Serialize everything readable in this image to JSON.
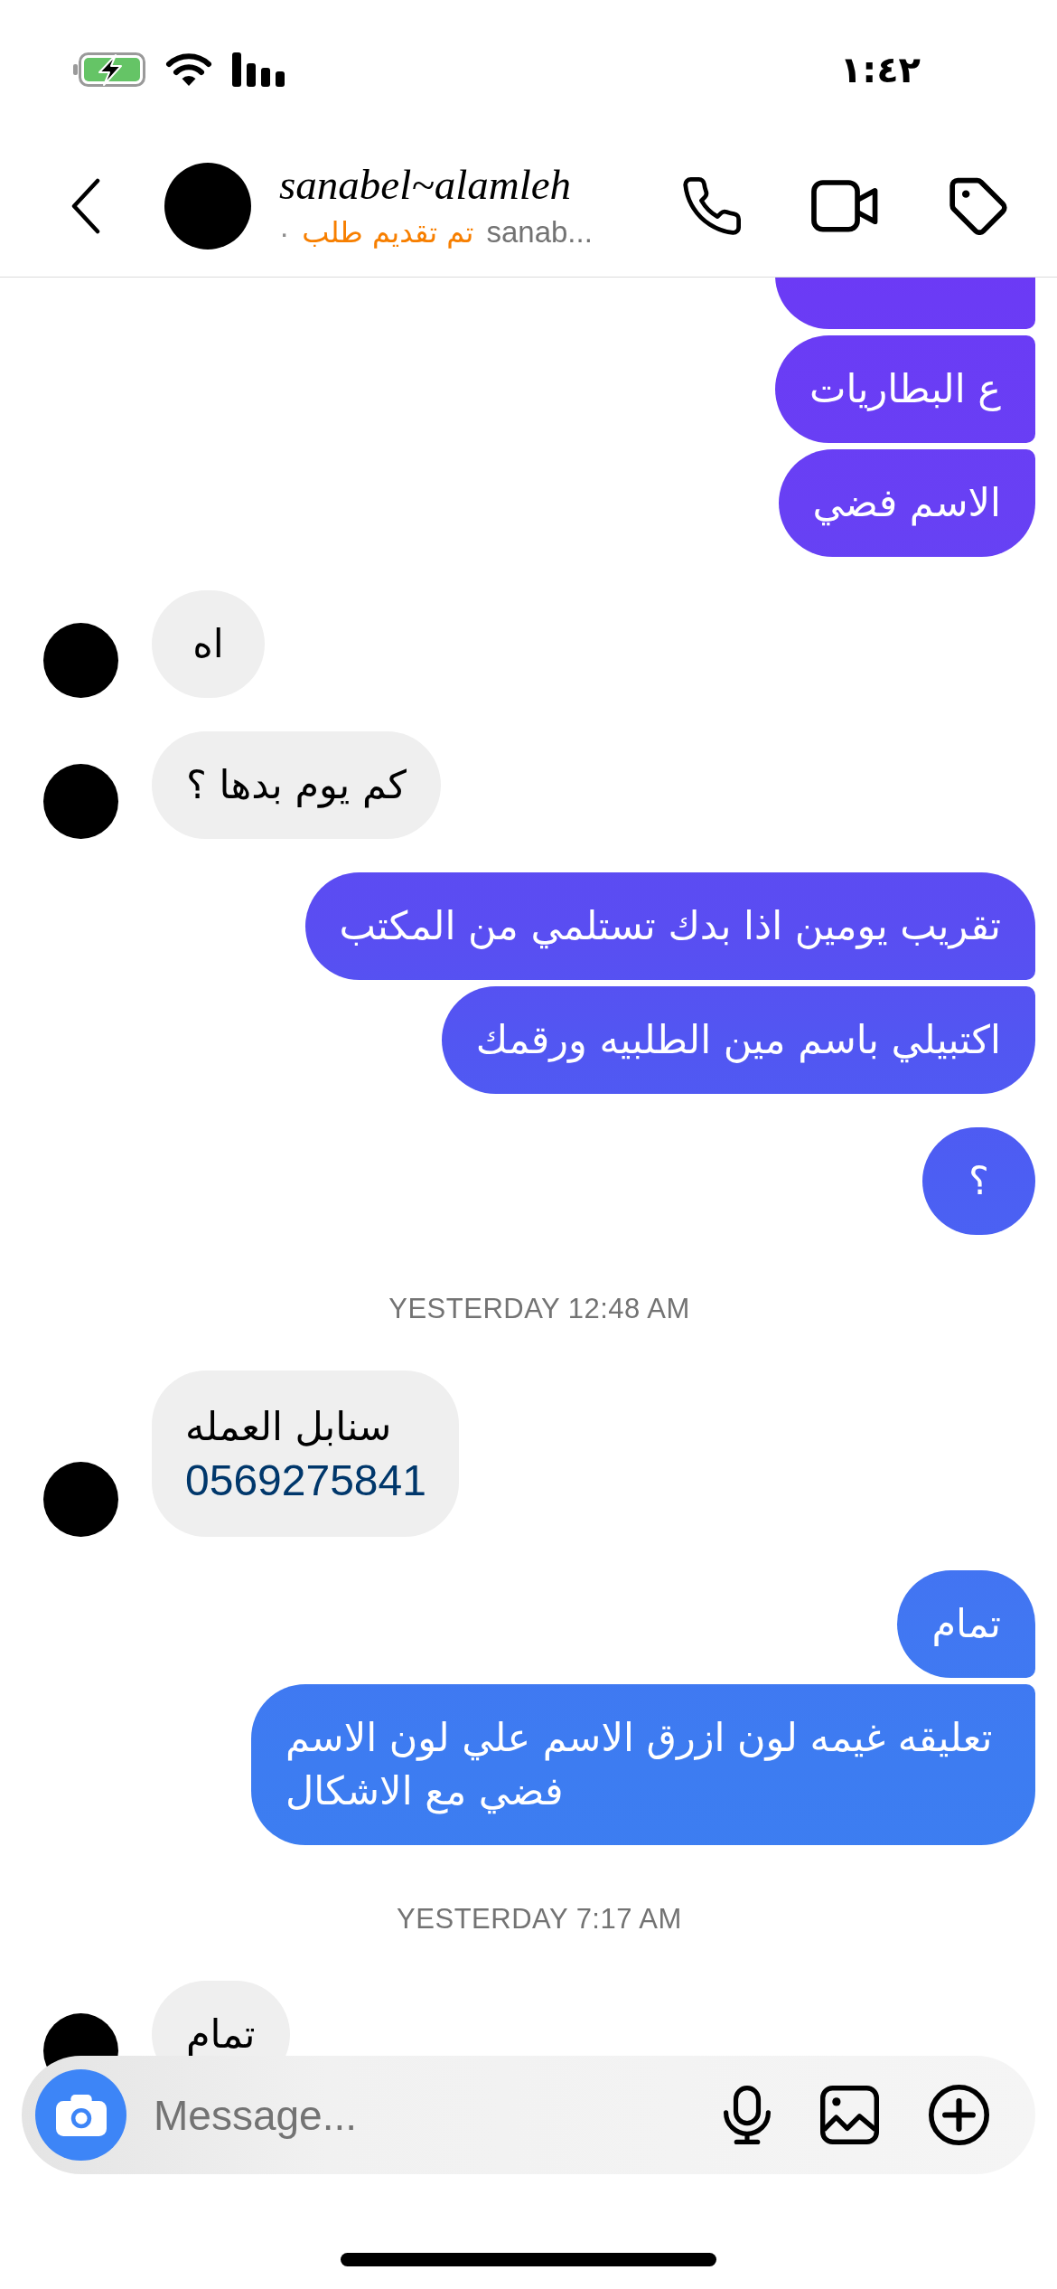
{
  "status_bar": {
    "time": "١:٤٢"
  },
  "header": {
    "name": "sanabel~alamleh",
    "username": "sanab...",
    "status": "تم تقديم طلب",
    "separator": "·"
  },
  "thread": [
    {
      "kind": "sent",
      "bubbles": [
        {
          "kind": "cut"
        },
        {
          "kind": "text",
          "text": "ع البطاريات"
        },
        {
          "kind": "text",
          "text": "الاسم فضي"
        }
      ]
    },
    {
      "kind": "received",
      "bubbles": [
        {
          "kind": "text",
          "text": "اه"
        }
      ]
    },
    {
      "kind": "received",
      "bubbles": [
        {
          "kind": "text",
          "text": "كم يوم بدها ؟"
        }
      ]
    },
    {
      "kind": "sent",
      "bubbles": [
        {
          "kind": "text",
          "text": "تقريب يومين اذا بدك تستلمي من المكتب"
        },
        {
          "kind": "text",
          "text": "اكتبيلي باسم مين الطلبيه ورقمك"
        }
      ]
    },
    {
      "kind": "sent",
      "bubbles": [
        {
          "kind": "text",
          "text": "؟"
        }
      ]
    },
    {
      "kind": "timestamp",
      "text": "YESTERDAY 12:48 AM"
    },
    {
      "kind": "received",
      "bubbles": [
        {
          "kind": "contact",
          "text": "سنابل العمله",
          "phone": "0569275841"
        }
      ]
    },
    {
      "kind": "sent",
      "bubbles": [
        {
          "kind": "text",
          "text": "تمام"
        },
        {
          "kind": "text",
          "text": "تعليقه غيمه لون ازرق الاسم علي لون الاسم فضي مع الاشكال"
        }
      ]
    },
    {
      "kind": "timestamp",
      "text": "YESTERDAY 7:17 AM"
    },
    {
      "kind": "received",
      "bubbles": [
        {
          "kind": "text",
          "text": "تمام"
        }
      ]
    }
  ],
  "composer": {
    "placeholder": "Message..."
  }
}
